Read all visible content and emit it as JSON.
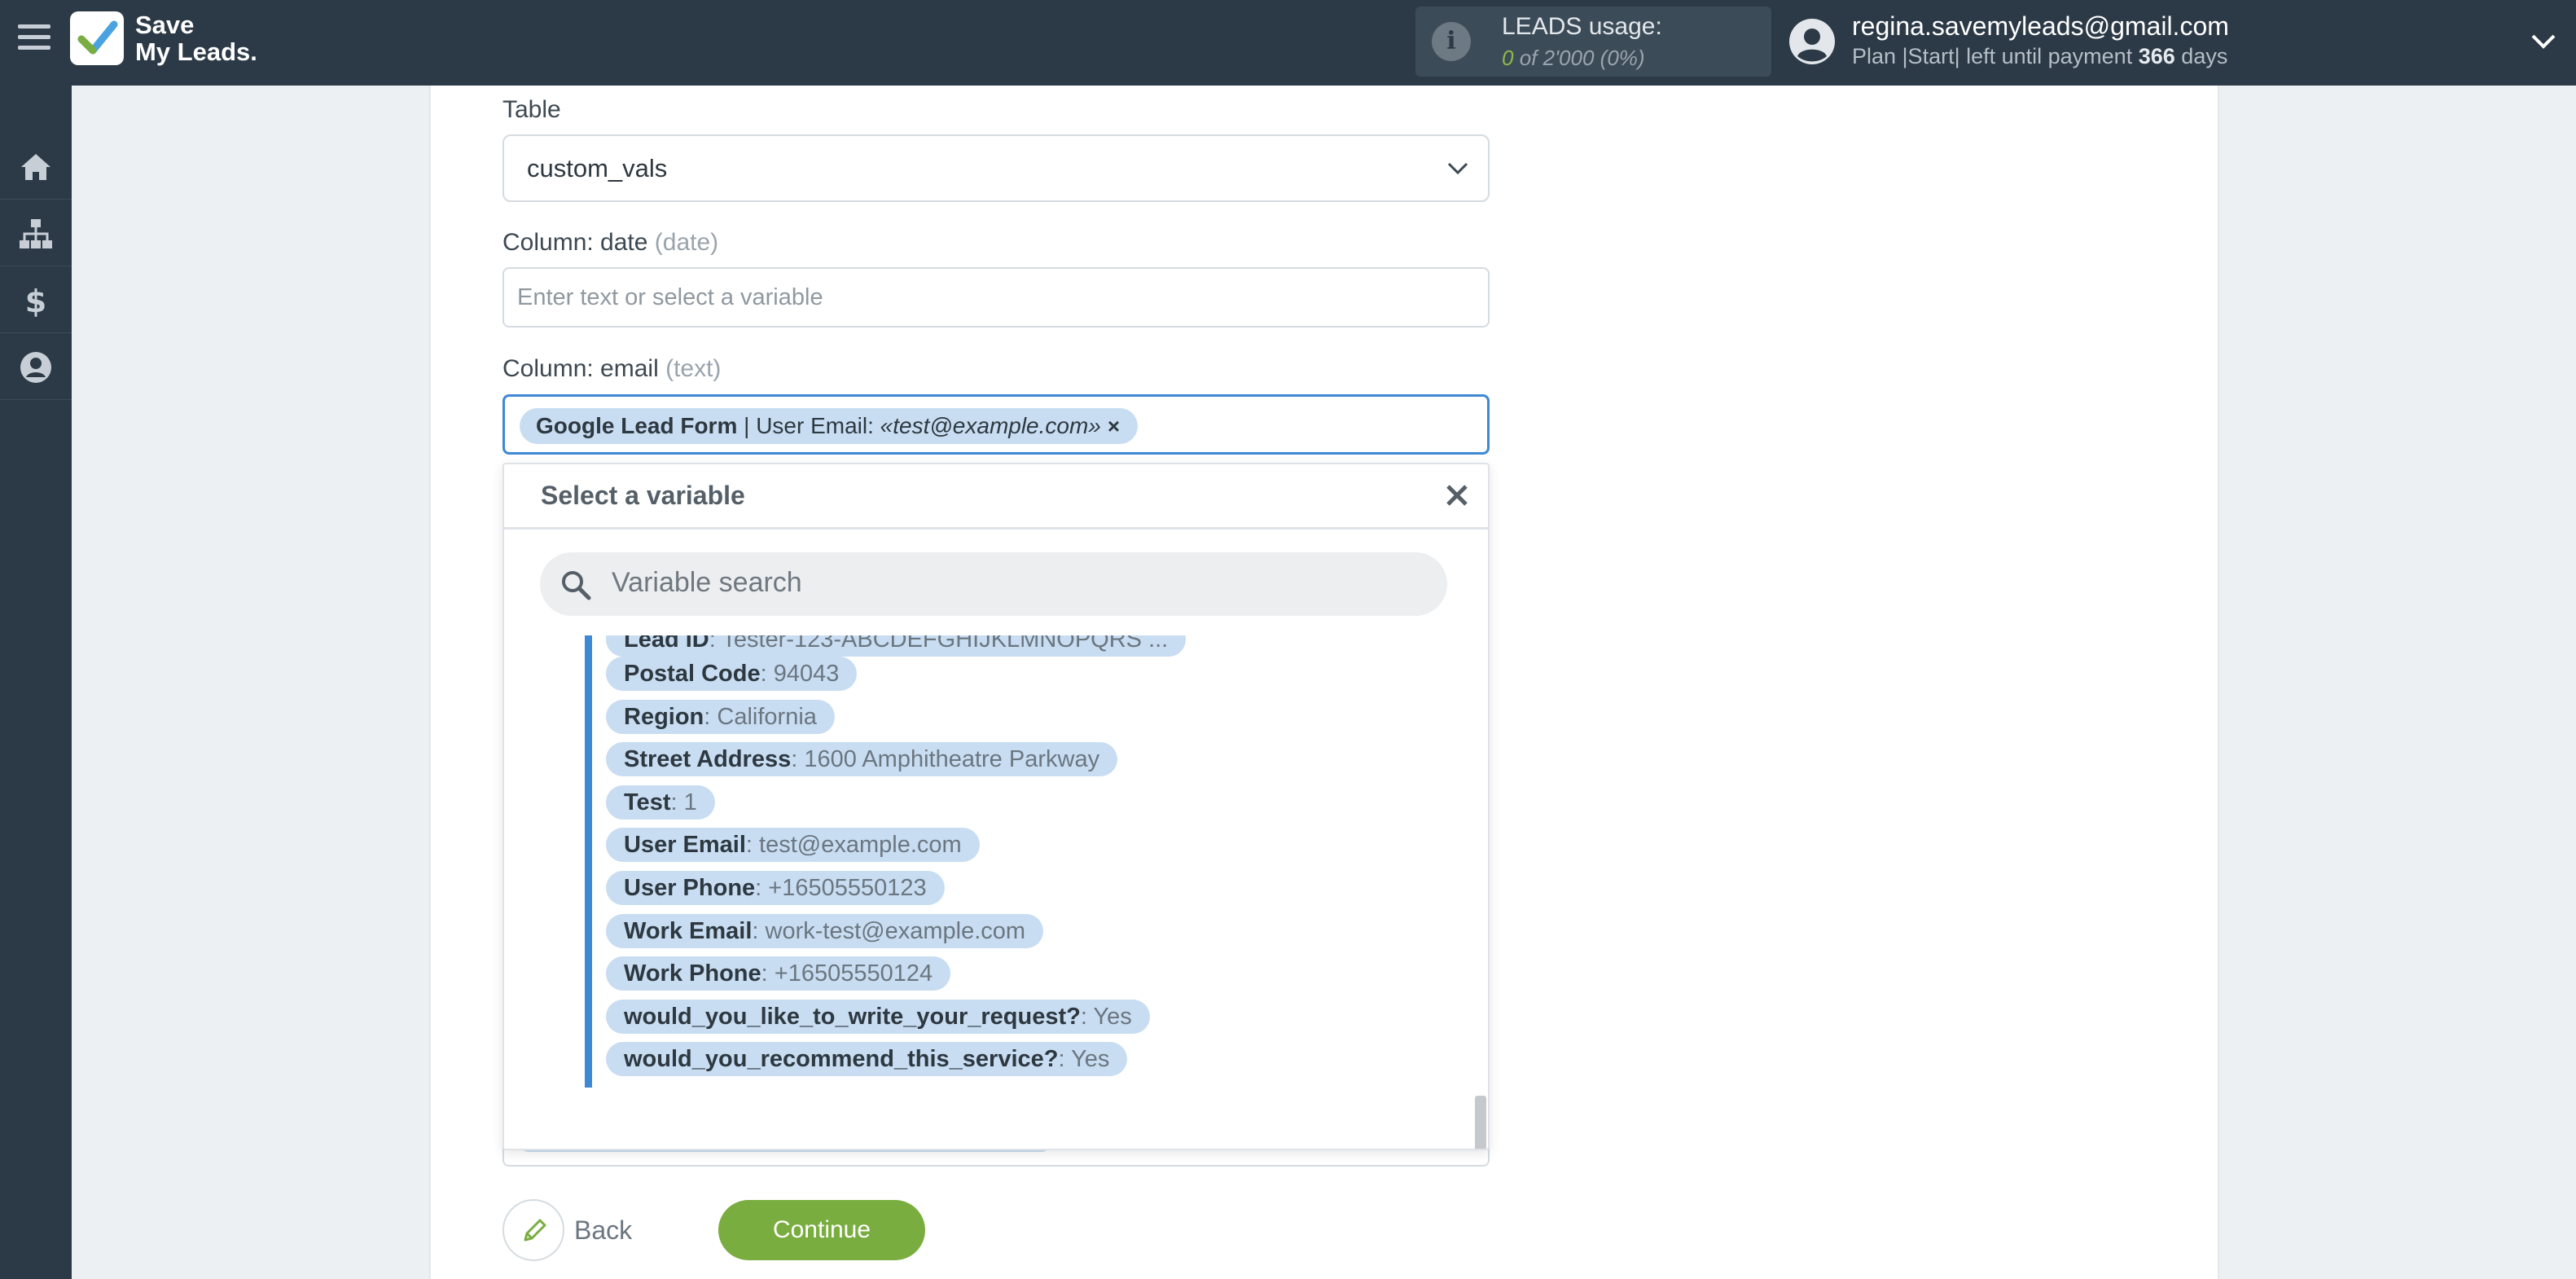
{
  "header": {
    "logo_line1": "Save",
    "logo_line2": "My Leads.",
    "usage_title": "LEADS usage:",
    "usage_used": "0",
    "usage_of": "of 2'000",
    "usage_pct": "(0%)",
    "user_email": "regina.savemyleads@gmail.com",
    "plan_prefix": "Plan |Start| left until payment",
    "plan_days": "366",
    "plan_suffix": "days"
  },
  "sidebar": {
    "items": [
      "home-icon",
      "sitemap-icon",
      "dollar-icon",
      "user-icon"
    ]
  },
  "form": {
    "table_label": "Table",
    "table_value": "custom_vals",
    "date_label": "Column: date",
    "date_type": "(date)",
    "date_placeholder": "Enter text or select a variable",
    "email_label": "Column: email",
    "email_type": "(text)",
    "email_chip": {
      "source": "Google Lead Form",
      "sep": " | User Email: ",
      "value": "«test@example.com»",
      "remove": "×"
    }
  },
  "dropdown": {
    "title": "Select a variable",
    "close": "×",
    "search_placeholder": "Variable search",
    "items": [
      {
        "name": "Lead ID",
        "value": "Tester-123-ABCDEFGHIJKLMNOPQRS ..."
      },
      {
        "name": "Postal Code",
        "value": "94043"
      },
      {
        "name": "Region",
        "value": "California"
      },
      {
        "name": "Street Address",
        "value": "1600 Amphitheatre Parkway"
      },
      {
        "name": "Test",
        "value": "1"
      },
      {
        "name": "User Email",
        "value": "test@example.com"
      },
      {
        "name": "User Phone",
        "value": "+16505550123"
      },
      {
        "name": "Work Email",
        "value": "work-test@example.com"
      },
      {
        "name": "Work Phone",
        "value": "+16505550124"
      },
      {
        "name": "would_you_like_to_write_your_request?",
        "value": "Yes"
      },
      {
        "name": "would_you_recommend_this_service?",
        "value": "Yes"
      }
    ]
  },
  "footer": {
    "back_label": "Back",
    "continue_label": "Continue"
  },
  "colors": {
    "topbar": "#2c3a47",
    "accent_blue": "#3f88d4",
    "chip_bg": "#c8ddf2",
    "continue_green": "#7aad40",
    "usage_green": "#8fb848"
  }
}
